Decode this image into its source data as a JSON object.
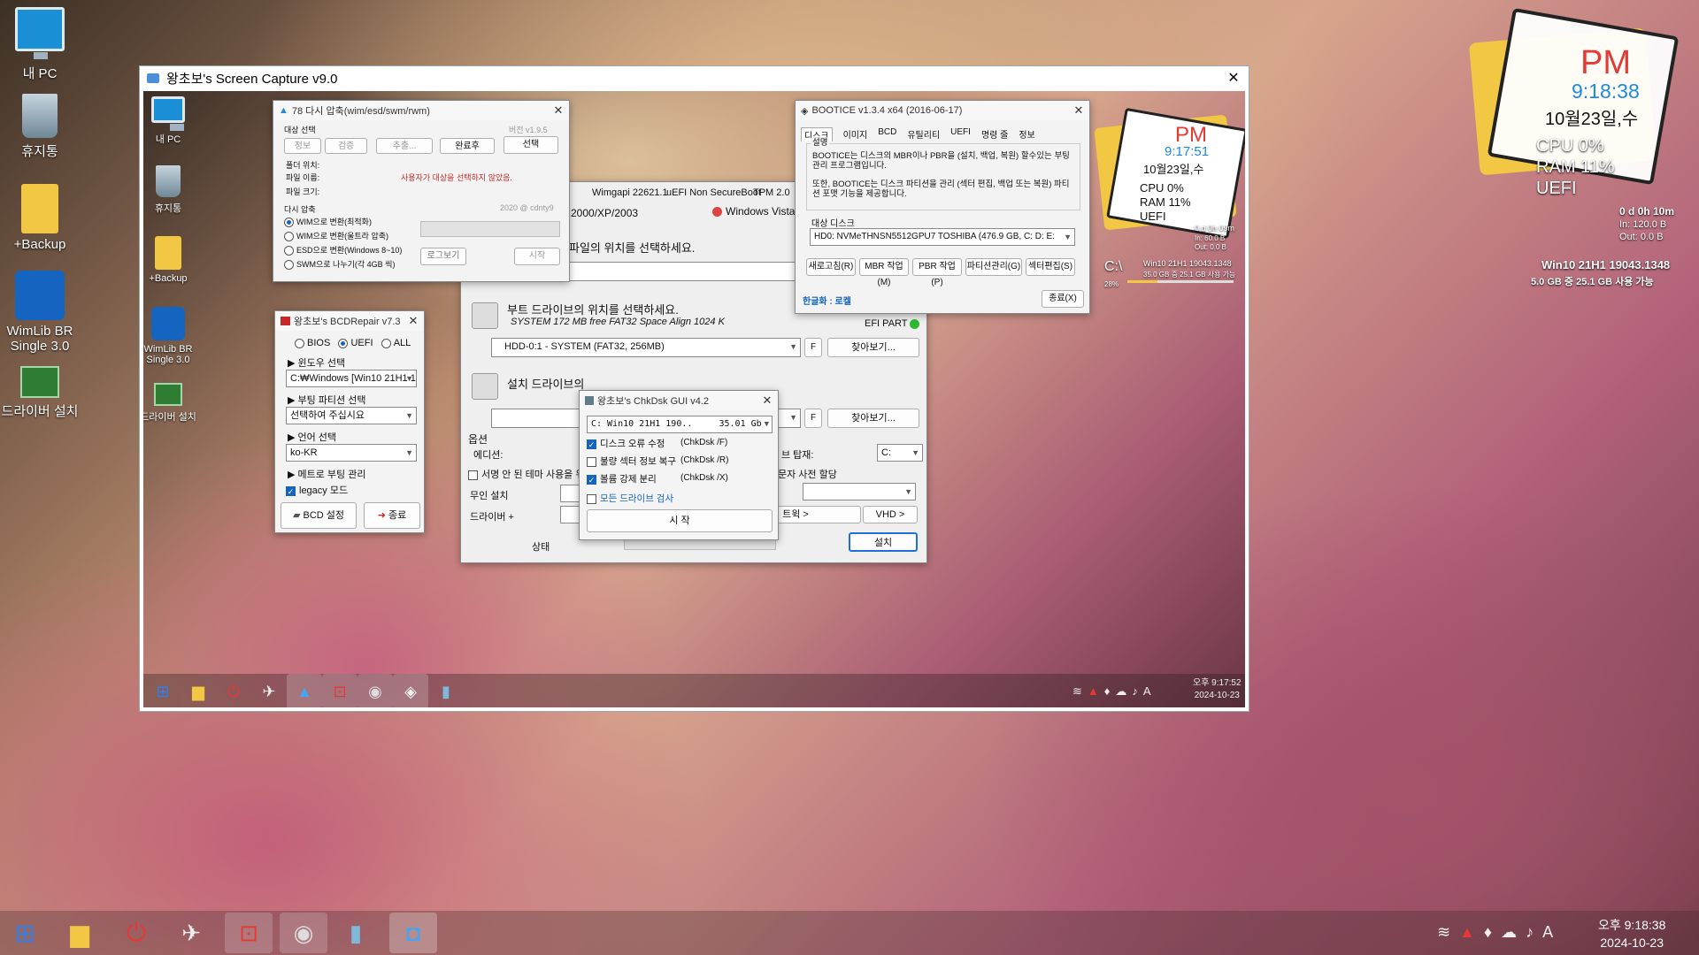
{
  "desktop": {
    "icons": [
      {
        "label": "내 PC"
      },
      {
        "label": "휴지통"
      },
      {
        "label": "+Backup"
      },
      {
        "label": "WimLib BR Single 3.0"
      },
      {
        "label": "드라이버 설치"
      }
    ]
  },
  "capture": {
    "title": "왕초보's Screen Capture v9.0",
    "close": "✕"
  },
  "inner_icons": [
    {
      "label": "내 PC"
    },
    {
      "label": "휴지통"
    },
    {
      "label": "+Backup"
    },
    {
      "label": "WimLib BR Single 3.0"
    },
    {
      "label": "드라이버 설치"
    }
  ],
  "recompress": {
    "title": "78 다시 압축(wim/esd/swm/rwm)",
    "target_label": "대상 선택",
    "version": "버전 v1.9.5",
    "buttons": [
      "정보",
      "검증",
      "추출...",
      "완료후",
      "선택"
    ],
    "folder_label": "폴더 위치:",
    "file_label": "파일 이름:",
    "size_label": "파일 크기:",
    "message": "사용자가 대상을 선택하지 않았음.",
    "section": "다시 압축",
    "credit": "2020 @ cdnty9",
    "options": [
      "WIM으로 변환(최적화)",
      "WIM으로 변환(울트라 압축)",
      "ESD으로 변환(Windows 8~10)",
      "SWM으로 나누기(각 4GB 씩)"
    ],
    "log_btn": "로그보기",
    "start_btn": "시작"
  },
  "bcd": {
    "title": "왕초보's BCDRepair v7.3",
    "radios": [
      "BIOS",
      "UEFI",
      "ALL"
    ],
    "win_label": "윈도우 선택",
    "win_value": "C:₩Windows  [Win10 21H1 1",
    "boot_label": "부팅 파티션 선택",
    "boot_value": "선택하여 주십시요",
    "lang_label": "언어 선택",
    "lang_value": "ko-KR",
    "metro_label": "메트로 부팅 관리",
    "legacy_label": "legacy 모드",
    "bcd_btn": "BCD 설정",
    "exit_btn": "종료"
  },
  "wimlib": {
    "header": [
      "Wimgapi 22621.1",
      "uEFI Non SecureBoot",
      "TPM 2.0"
    ],
    "os_left": "2000/XP/2003",
    "os_right": "Windows Vista/7",
    "file_prompt": "파일의 위치를 선택하세요.",
    "boot_prompt": "부트 드라이브의 위치를 선택하세요.",
    "boot_sub": "SYSTEM 172 MB free FAT32 Space Align 1024 K",
    "efi": "EFI PART",
    "boot_combo": "HDD-0:1 -  SYSTEM (FAT32, 256MB)",
    "f": "F",
    "browse": "찾아보기...",
    "install_prompt": "설치 드라이브의",
    "options": "옵션",
    "edition": "에디션:",
    "mount": "브 탑재:",
    "mount_val": "C:",
    "unsigned": "서명 안 된 테마 사용을 위",
    "letter": "문자 사전 할당",
    "unattend": "무인 설치",
    "driver": "드라이버 +",
    "tweak": "트윅 >",
    "vhd": "VHD >",
    "status": "상태",
    "install": "설치"
  },
  "bootice": {
    "title": "BOOTICE v1.3.4 x64 (2016-06-17)",
    "tabs": [
      "디스크",
      "이미지",
      "BCD",
      "유틸리티",
      "UEFI",
      "명령 줄",
      "정보"
    ],
    "desc_label": "설명",
    "desc1": "BOOTICE는 디스크의 MBR이나 PBR을 (설치, 백업, 복원) 할수있는 부팅관리 프로그램입니다.",
    "desc2": "또한, BOOTICE는 디스크 파티션을 관리 (섹터 편집, 백업 또는 복원) 파티션 포맷 기능을 제공합니다.",
    "disk_label": "대상 디스크",
    "disk_value": "HD0: NVMeTHNSN5512GPU7 TOSHIBA (476.9 GB, C: D: E:",
    "buttons": [
      "새로고침(R)",
      "MBR 작업(M)",
      "PBR 작업(P)",
      "파티션관리(G)",
      "섹터편집(S)"
    ],
    "lang": "한글화 : 로켈",
    "close": "종료(X)"
  },
  "chkdsk": {
    "title": "왕초보's ChkDsk GUI v4.2",
    "drive": "C: Win10 21H1 190..     35.01 Gb",
    "items": [
      {
        "label": "디스크 오류 수정",
        "cmd": "(ChkDsk /F)",
        "on": true
      },
      {
        "label": "불량 섹터 정보 복구",
        "cmd": "(ChkDsk /R)",
        "on": false
      },
      {
        "label": "볼륨 강제 분리",
        "cmd": "(ChkDsk /X)",
        "on": true
      }
    ],
    "all_label": "모든 드라이브 검사",
    "start": "시 작"
  },
  "inner_widget": {
    "ampm": "PM",
    "time": "9:17:51",
    "date": "10월23일,수",
    "cpu": "CPU  0%",
    "ram": "RAM  11%",
    "uefi": "UEFI",
    "uptime": "0 d 0h 09m",
    "in": "In: 60.0 B",
    "out": "Out: 0.0 B",
    "drive": "C:\\",
    "drive_name": "Win10 21H1 19043.1348",
    "drive_free": "35.0 GB 중   25.1 GB 사용 가능",
    "drive_pct": "28%"
  },
  "outer_widget": {
    "ampm": "PM",
    "time": "9:18:38",
    "date": "10월23일,수",
    "cpu": "CPU  0%",
    "ram": "RAM  11%",
    "uefi": "UEFI",
    "uptime": "0 d 0h 10m",
    "in": "In: 120.0 B",
    "out": "Out: 0.0 B",
    "drive_name": "Win10 21H1 19043.1348",
    "drive_free": "5.0 GB 중   25.1 GB 사용 가능"
  },
  "inner_tray": {
    "time": "오후 9:17:52",
    "date": "2024-10-23",
    "ime": "A"
  },
  "tray": {
    "time": "오후 9:18:38",
    "date": "2024-10-23",
    "ime": "A"
  }
}
